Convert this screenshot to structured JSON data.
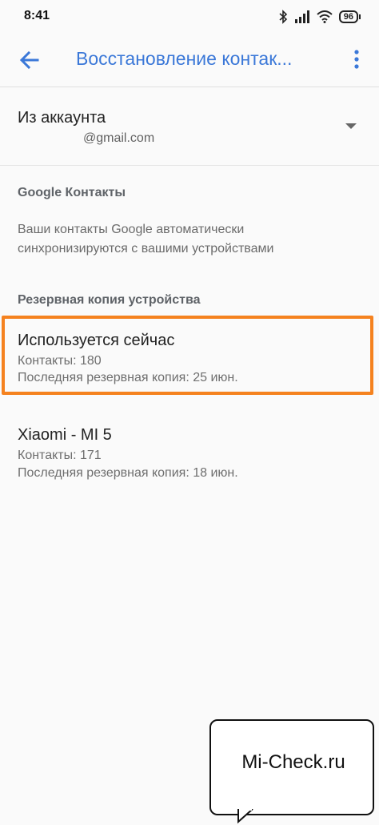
{
  "status_bar": {
    "time": "8:41",
    "battery": "96"
  },
  "toolbar": {
    "title": "Восстановление контак..."
  },
  "account": {
    "label": "Из аккаунта",
    "email": "@gmail.com"
  },
  "google_contacts": {
    "heading": "Google Контакты",
    "line1": "Ваши контакты Google автоматически",
    "line2": "синхронизируются с вашими устройствами"
  },
  "device_backup": {
    "heading": "Резервная копия устройства",
    "items": [
      {
        "title": "Используется сейчас",
        "contacts": "Контакты: 180",
        "last_backup": "Последняя резервная копия: 25 июн."
      },
      {
        "title": "Xiaomi - MI 5",
        "contacts": "Контакты: 171",
        "last_backup": "Последняя резервная копия: 18 июн."
      }
    ]
  },
  "watermark": {
    "text": "Mi-Check.ru"
  },
  "colors": {
    "accent": "#3b78d8",
    "highlight": "#f5821f"
  }
}
